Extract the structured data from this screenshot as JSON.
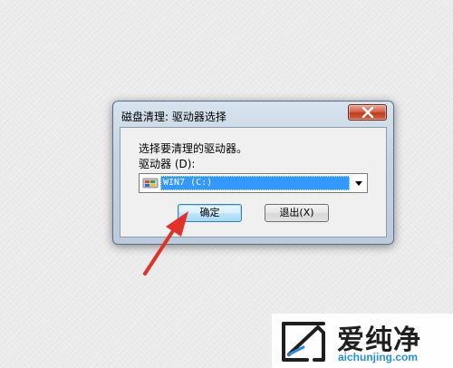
{
  "dialog": {
    "title": "磁盘清理: 驱动器选择",
    "prompt": "选择要清理的驱动器。",
    "drive_label": "驱动器 (D):",
    "selected_drive": "WIN7 (C:)",
    "drive_icon": "drive-icon",
    "ok_label": "确定",
    "exit_label": "退出(X)",
    "close_icon": "close-icon"
  },
  "annotation": {
    "arrow_icon": "red-arrow-icon",
    "color": "#e0312a"
  },
  "watermark": {
    "brand_cn": "爱纯净",
    "url": "aichunjing.com"
  },
  "colors": {
    "selection": "#3399ff",
    "close_button": "#c03a1e",
    "watermark_url": "#2a8fd8"
  }
}
